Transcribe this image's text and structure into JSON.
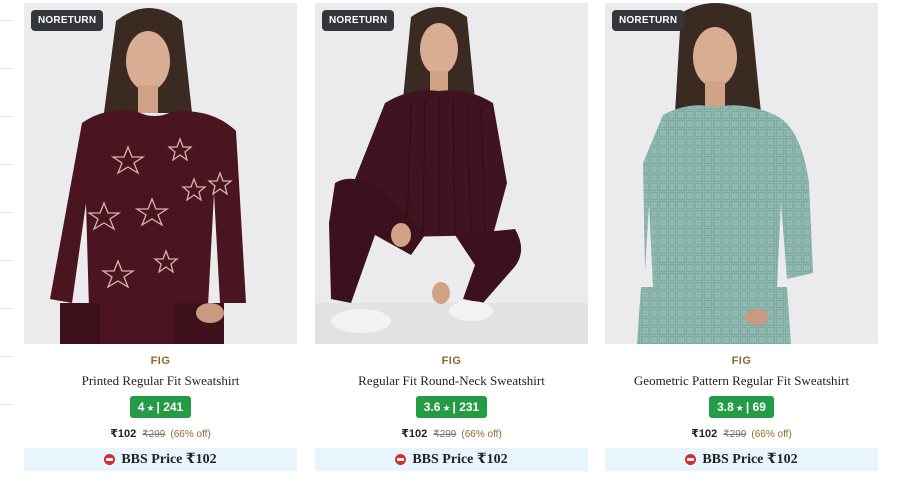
{
  "badge_label": "NORETURN",
  "colors": {
    "brand": "#8b6a2b",
    "rating_bg": "#239c45",
    "bbs_bg": "#e8f5fc",
    "badge_bg": "#33363a"
  },
  "products": [
    {
      "brand": "FIG",
      "name": "Printed Regular Fit Sweatshirt",
      "rating": "4",
      "star": "★",
      "reviews": "| 241",
      "price": "₹102",
      "mrp": "₹299",
      "discount": "(66% off)",
      "bbs_label": "BBS Price ₹102",
      "image_icon": "maroon-star-velvet-sweatshirt"
    },
    {
      "brand": "FIG",
      "name": "Regular Fit Round-Neck Sweatshirt",
      "rating": "3.6",
      "star": "★",
      "reviews": "| 231",
      "price": "₹102",
      "mrp": "₹299",
      "discount": "(66% off)",
      "bbs_label": "BBS Price ₹102",
      "image_icon": "maroon-ribbed-sweatshirt"
    },
    {
      "brand": "FIG",
      "name": "Geometric Pattern Regular Fit Sweatshirt",
      "rating": "3.8",
      "star": "★",
      "reviews": "| 69",
      "price": "₹102",
      "mrp": "₹299",
      "discount": "(66% off)",
      "bbs_label": "BBS Price ₹102",
      "image_icon": "sage-textured-sweatshirt"
    }
  ]
}
